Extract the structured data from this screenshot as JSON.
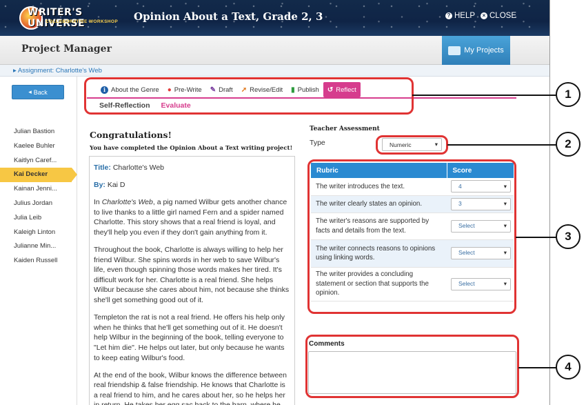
{
  "header": {
    "logo_title": "WRITER'S UNIVERSE",
    "logo_subtitle": "COLLABORATIVE WORKSHOP",
    "title": "Opinion About a Text, Grade 2, 3",
    "help_label": "HELP",
    "close_label": "CLOSE"
  },
  "subheader": {
    "title": "Project Manager",
    "my_projects_label": "My Projects"
  },
  "breadcrumb": "Assignment: Charlotte's Web",
  "sidebar": {
    "back_label": "Back",
    "students": [
      {
        "name": "Julian Bastion"
      },
      {
        "name": "Kaelee Buhler"
      },
      {
        "name": "Kaitlyn Caref..."
      },
      {
        "name": "Kai Decker",
        "active": true
      },
      {
        "name": "Kainan Jenni..."
      },
      {
        "name": "Julius Jordan"
      },
      {
        "name": "Julia Leib"
      },
      {
        "name": "Kaleigh Linton"
      },
      {
        "name": "Julianne Min..."
      },
      {
        "name": "Kaiden Russell"
      }
    ]
  },
  "tabs": [
    {
      "label": "About the Genre",
      "icon": "info-icon",
      "color": "#1f5fa8"
    },
    {
      "label": "Pre-Write",
      "icon": "lightbulb-icon",
      "color": "#e23b3b"
    },
    {
      "label": "Draft",
      "icon": "pencil-icon",
      "color": "#7a3fa0"
    },
    {
      "label": "Revise/Edit",
      "icon": "cursor-icon",
      "color": "#e07a1f"
    },
    {
      "label": "Publish",
      "icon": "document-icon",
      "color": "#2e9b3e"
    },
    {
      "label": "Reflect",
      "icon": "undo-icon",
      "color": "#d63c8d",
      "active": true
    }
  ],
  "subtabs": [
    {
      "label": "Self-Reflection"
    },
    {
      "label": "Evaluate",
      "active": true
    }
  ],
  "main": {
    "heading": "Congratulations!",
    "completed_text": "You have completed the Opinion About a Text writing project!",
    "title_label": "Title:",
    "title_value": "Charlotte's Web",
    "by_label": "By:",
    "by_value": "Kai D",
    "paragraph1_book": "Charlotte's Web",
    "paragraph1_prefix": "In ",
    "paragraph1_rest": ", a pig named Wilbur gets another chance to live thanks to a little girl named Fern and a spider named Charlotte. This story shows that a real friend is loyal, and they'll help you even if they don't gain anything from it.",
    "paragraph2": "Throughout the book, Charlotte is always willing to help her friend Wilbur. She spins words in her web to save Wilbur's life, even though spinning those words makes her tired. It's difficult work for her. Charlotte is a real friend. She helps Wilbur because she cares about him, not because she thinks she'll get something good out of it.",
    "paragraph3": "Templeton the rat is not a real friend. He offers his help only when he thinks that he'll get something out of it. He doesn't help Wilbur in the beginning of the book, telling everyone to \"Let him die\". He helps out later, but only because he wants to keep eating Wilbur's food.",
    "paragraph4": "At the end of the book, Wilbur knows the difference between real friendship & false friendship. He knows that Charlotte is a real friend to him, and he cares about her, so he helps her in return. He takes her egg sac back to the barn, where he"
  },
  "assessment": {
    "title": "Teacher Assessment",
    "type_label": "Type",
    "type_value": "Numeric",
    "rubric_header": "Rubric",
    "score_header": "Score",
    "rows": [
      {
        "criterion": "The writer introduces the text.",
        "score": "4"
      },
      {
        "criterion": "The writer clearly states an opinion.",
        "score": "3"
      },
      {
        "criterion": "The writer's reasons are supported by facts and details from the text.",
        "score": "Select"
      },
      {
        "criterion": "The writer connects reasons to opinions using linking words.",
        "score": "Select"
      },
      {
        "criterion": "The writer provides a concluding statement or section that supports the opinion.",
        "score": "Select"
      }
    ],
    "comments_label": "Comments"
  },
  "callouts": [
    "1",
    "2",
    "3",
    "4"
  ],
  "colors": {
    "accent": "#d63c8d",
    "primary": "#2a8ad1",
    "highlight": "#e03333",
    "active_student": "#f7c744"
  }
}
